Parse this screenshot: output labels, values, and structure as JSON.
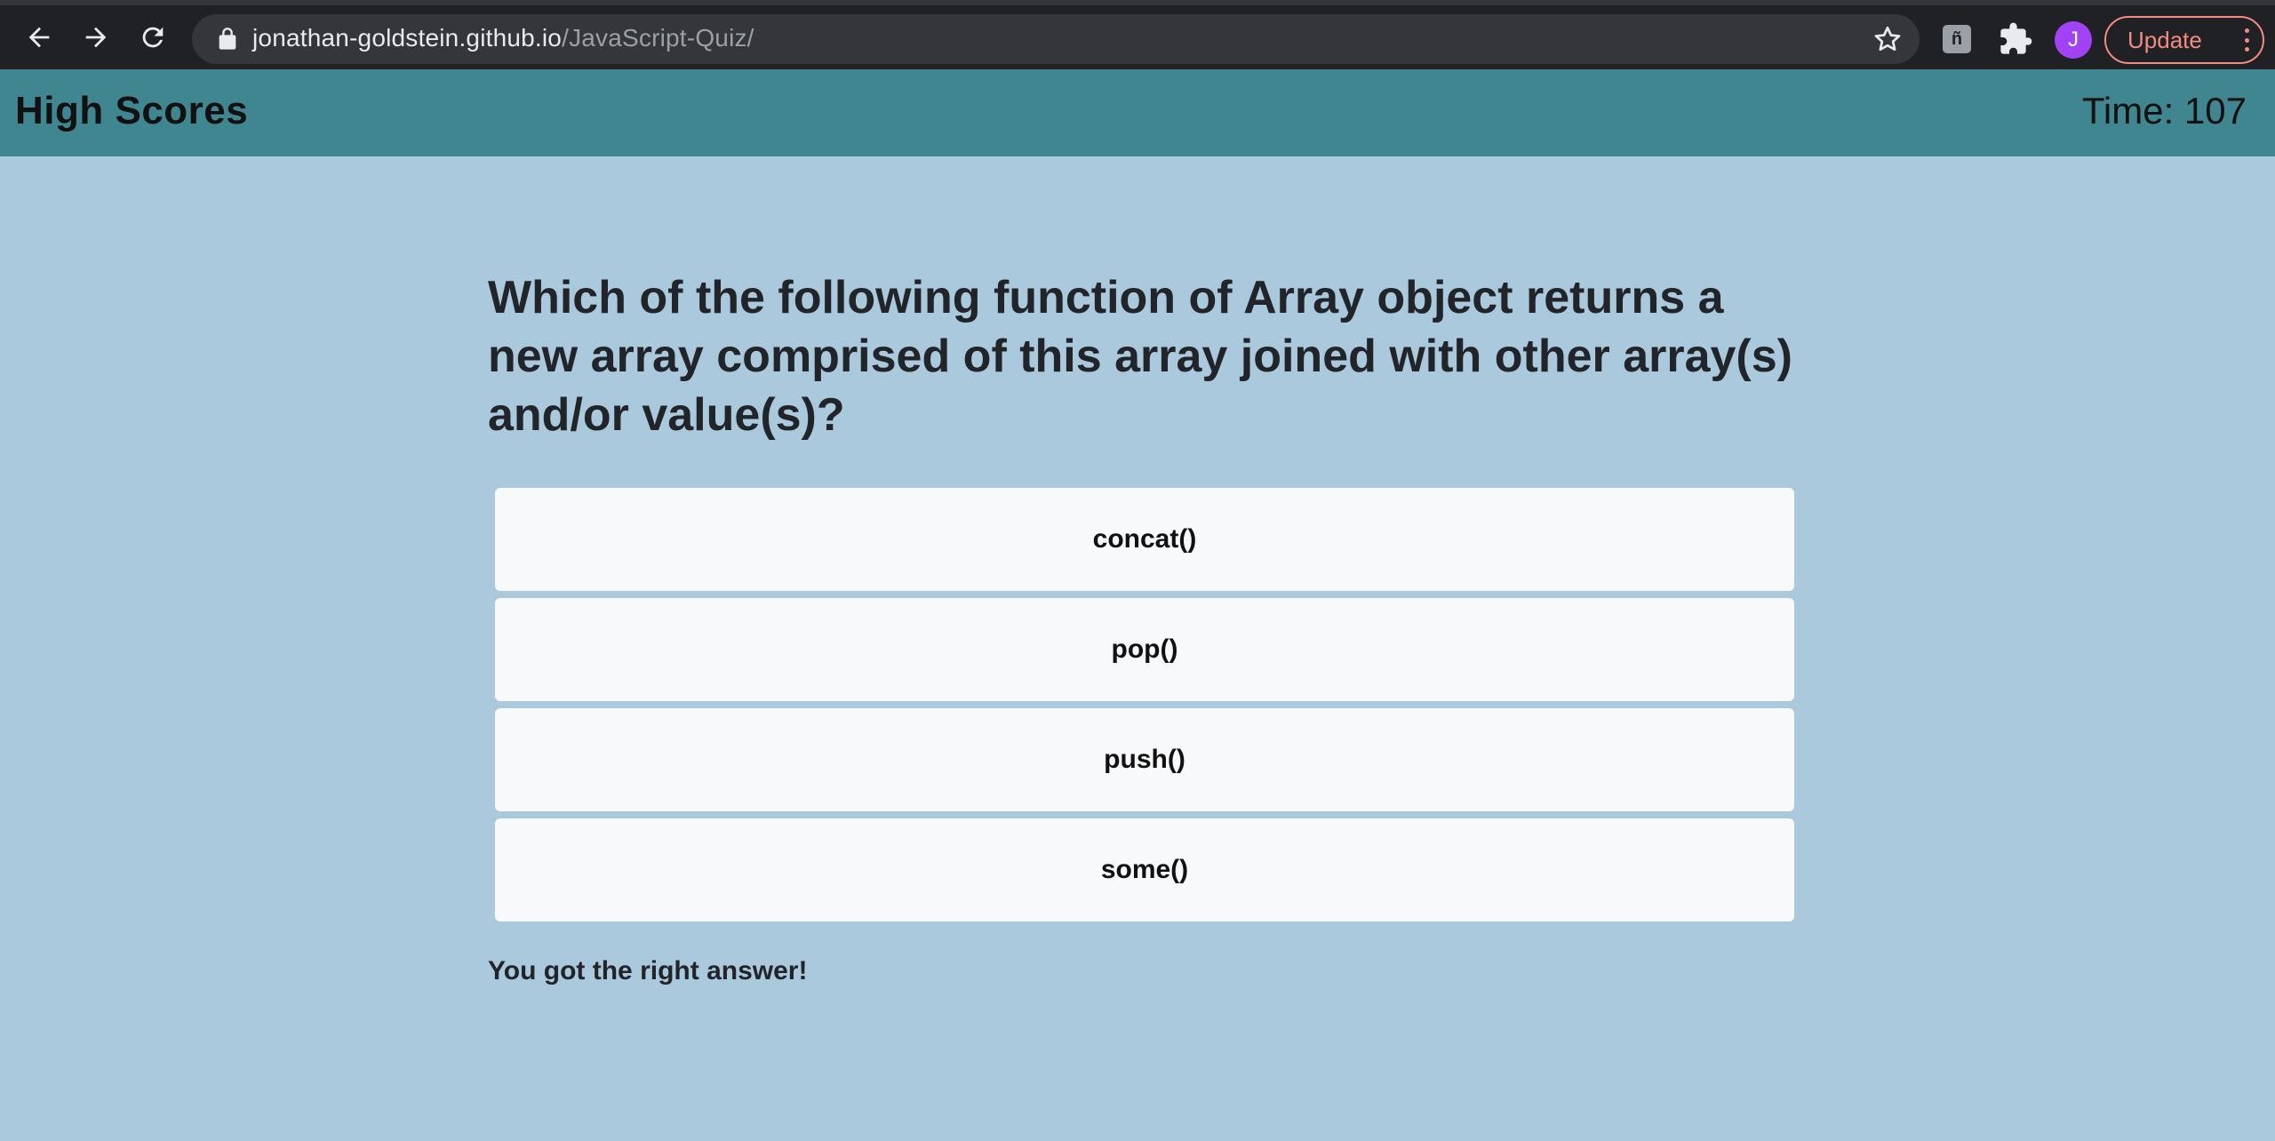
{
  "browser": {
    "url_host": "jonathan-goldstein.github.io",
    "url_path": "/JavaScript-Quiz/",
    "avatar_initial": "J",
    "update_label": "Update",
    "extension_letter": "ñ"
  },
  "header": {
    "high_scores_label": "High Scores",
    "timer_text": "Time: 107"
  },
  "quiz": {
    "question": "Which of the following function of Array object returns a new array comprised of this array joined with other array(s) and/or value(s)?",
    "choices": [
      "concat()",
      "pop()",
      "push()",
      "some()"
    ],
    "feedback": "You got the right answer!"
  },
  "colors": {
    "page_background": "#aac9dd",
    "header_background": "#3f8690",
    "choice_background": "#f8f9fb"
  }
}
